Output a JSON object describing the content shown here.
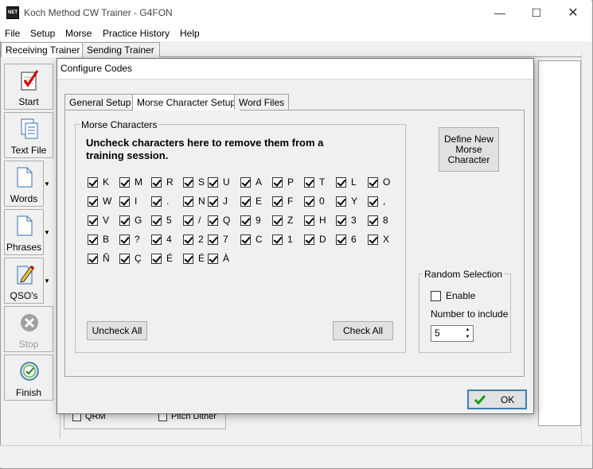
{
  "window": {
    "title": "Koch Method CW Trainer - G4FON",
    "app_icon_text": "NET"
  },
  "menu": [
    "File",
    "Setup",
    "Morse",
    "Practice History",
    "Help"
  ],
  "main_tabs": [
    "Receiving Trainer",
    "Sending Trainer"
  ],
  "toolbar": [
    {
      "label": "Start",
      "icon": "start-icon"
    },
    {
      "label": "Text File",
      "icon": "text-file-icon"
    },
    {
      "label": "Words",
      "icon": "words-icon"
    },
    {
      "label": "Phrases",
      "icon": "phrases-icon"
    },
    {
      "label": "QSO's",
      "icon": "qsos-icon"
    },
    {
      "label": "Stop",
      "icon": "stop-icon"
    },
    {
      "label": "Finish",
      "icon": "finish-icon"
    }
  ],
  "background": {
    "qrm_label": "QRM",
    "pitch_dither_label": "Pitch Dither"
  },
  "dialog": {
    "title": "Configure Codes",
    "tabs": [
      "General Setup",
      "Morse Character Setup",
      "Word Files"
    ],
    "morse_group_title": "Morse Characters",
    "instruction": "Uncheck characters here to remove them from a training session.",
    "characters": [
      [
        "K",
        "M",
        "R",
        "S",
        "U",
        "A",
        "P",
        "T",
        "L",
        "O"
      ],
      [
        "W",
        "I",
        ".",
        "N",
        "J",
        "E",
        "F",
        "0",
        "Y",
        ","
      ],
      [
        "V",
        "G",
        "5",
        "/",
        "Q",
        "9",
        "Z",
        "H",
        "3",
        "8"
      ],
      [
        "B",
        "?",
        "4",
        "2",
        "7",
        "C",
        "1",
        "D",
        "6",
        "X"
      ],
      [
        "Ñ",
        "Ç",
        "É",
        "É",
        "À"
      ]
    ],
    "uncheck_all_label": "Uncheck All",
    "check_all_label": "Check All",
    "define_new_label": "Define New Morse Character",
    "random_group_title": "Random Selection",
    "enable_label": "Enable",
    "enable_checked": false,
    "number_label": "Number to include",
    "number_value": "5",
    "ok_label": "OK"
  }
}
